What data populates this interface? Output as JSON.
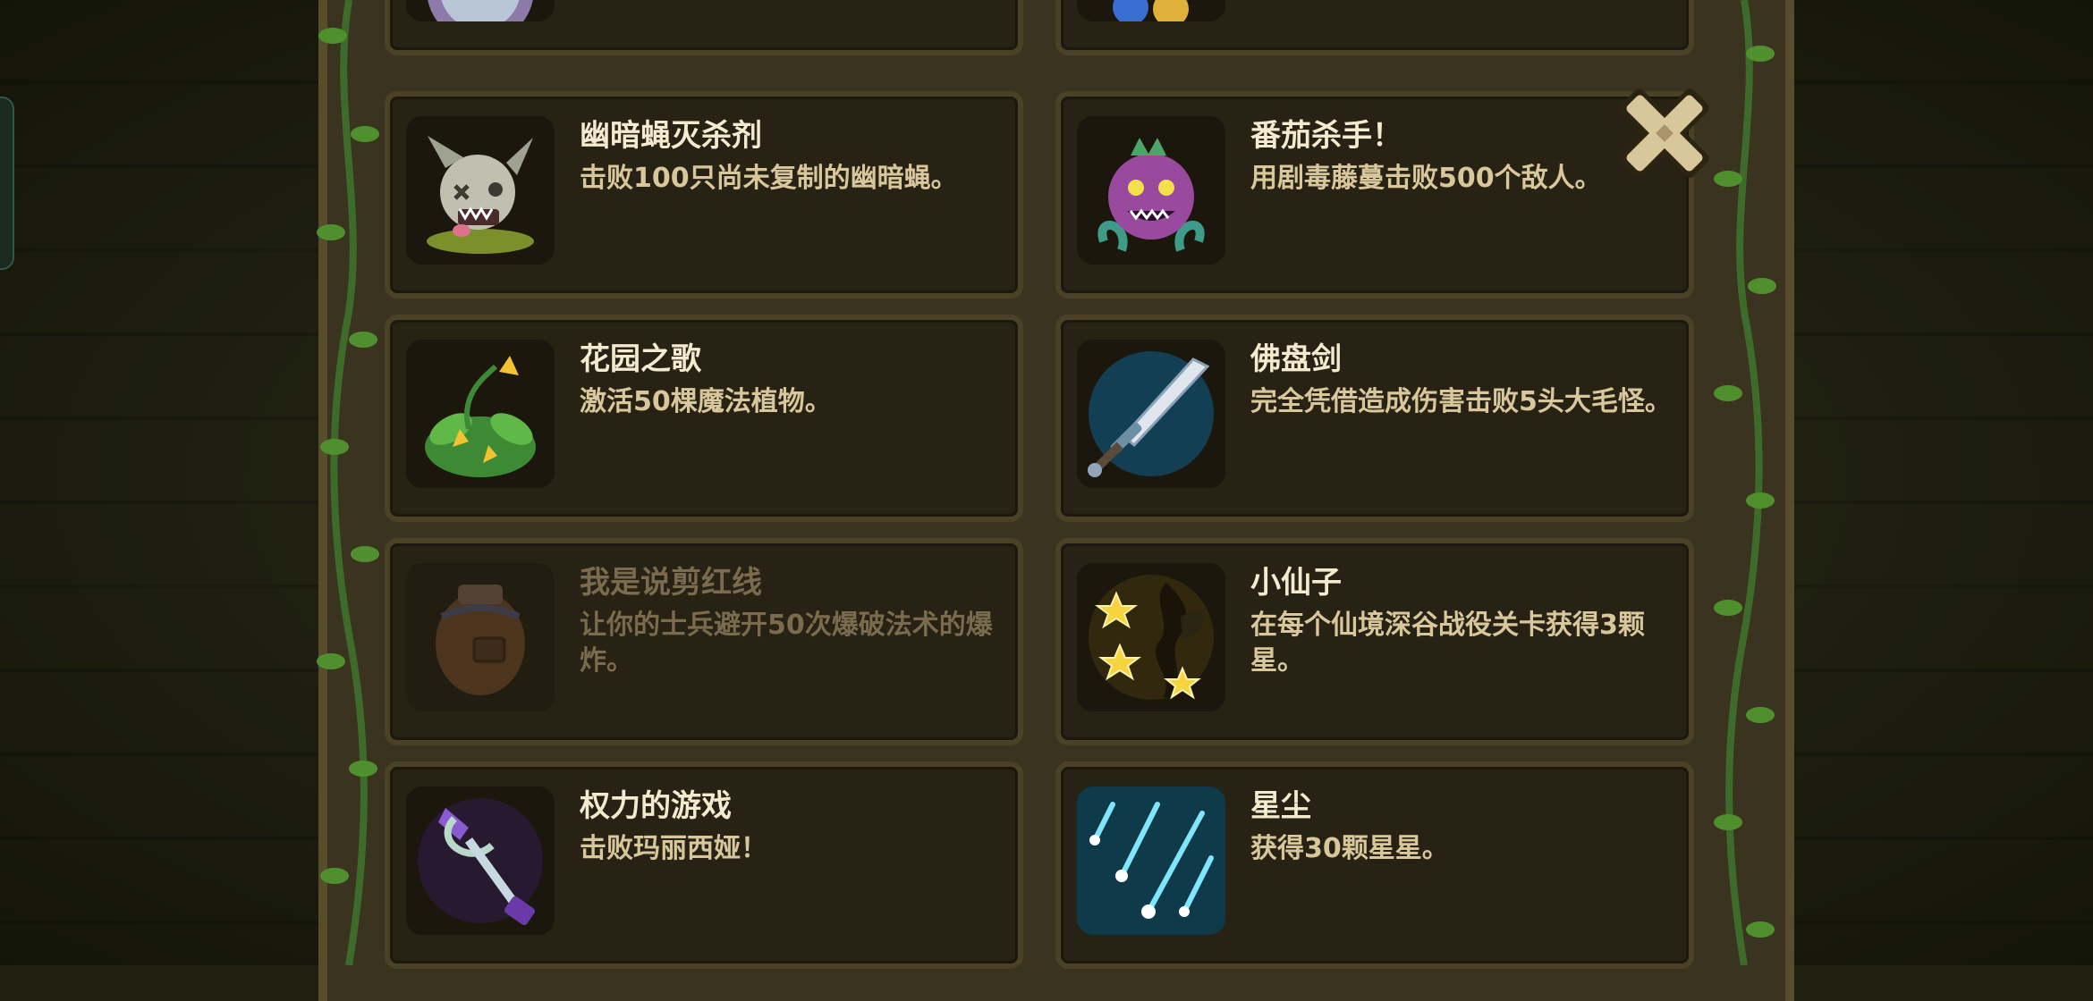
{
  "achievements": [
    {
      "title": "幽暗蝇灭杀剂",
      "desc": "击败100只尚未复制的幽暗蝇。",
      "icon": "fly-skull-icon",
      "locked": false
    },
    {
      "title": "番茄杀手！",
      "desc": "用剧毒藤蔓击败500个敌人。",
      "icon": "evil-tomato-icon",
      "locked": false
    },
    {
      "title": "花园之歌",
      "desc": "激活50棵魔法植物。",
      "icon": "magic-plant-icon",
      "locked": false
    },
    {
      "title": "佛盘剑",
      "desc": "完全凭借造成伤害击败5头大毛怪。",
      "icon": "sword-icon",
      "locked": false
    },
    {
      "title": "我是说剪红线",
      "desc": "让你的士兵避开50次爆破法术的爆炸。",
      "icon": "bomb-pack-icon",
      "locked": true
    },
    {
      "title": "小仙子",
      "desc": "在每个仙境深谷战役关卡获得3颗星。",
      "icon": "fairy-stars-icon",
      "locked": false
    },
    {
      "title": "权力的游戏",
      "desc": "击败玛丽西娅！",
      "icon": "scepter-icon",
      "locked": false
    },
    {
      "title": "星尘",
      "desc": "获得30颗星星。",
      "icon": "stardust-icon",
      "locked": false
    }
  ],
  "close_icon": "close-x-icon"
}
